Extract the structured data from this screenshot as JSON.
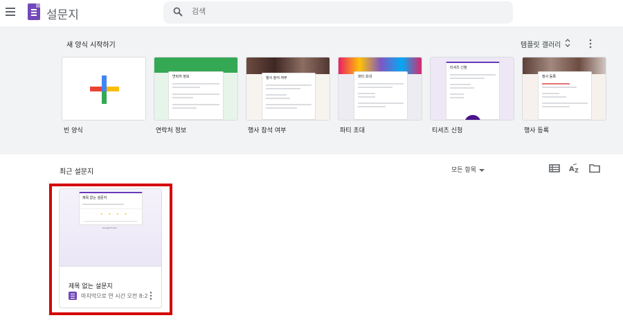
{
  "app": {
    "title": "설문지"
  },
  "search": {
    "placeholder": "검색"
  },
  "templates": {
    "section_title": "새 양식 시작하기",
    "gallery_label": "템플릿 갤러리",
    "items": [
      {
        "label": "빈 양식"
      },
      {
        "label": "연락처 정보",
        "thumb_title": "연락처 정보"
      },
      {
        "label": "행사 참석 여부",
        "thumb_title": "행사 참석 여부"
      },
      {
        "label": "파티 초대",
        "thumb_title": "파티 초대"
      },
      {
        "label": "티셔츠 신청",
        "thumb_title": "티셔츠 신청"
      },
      {
        "label": "행사 등록",
        "thumb_title": "행사 등록"
      }
    ]
  },
  "recent": {
    "title": "최근 설문지",
    "filter_label": "모든 항목",
    "documents": [
      {
        "title": "제목 없는 설문지",
        "thumb_title": "제목 없는 설문지",
        "meta": "마지막으로 연 시간 오전 8:2",
        "thumb_footer": "Google Forms"
      }
    ]
  },
  "colors": {
    "accent": "#7248b9",
    "highlight": "#d50000",
    "template_bg": "#f1f3f4"
  }
}
